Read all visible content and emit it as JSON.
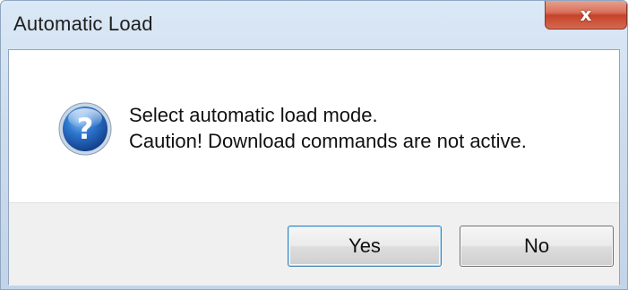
{
  "window": {
    "title": "Automatic Load",
    "close_symbol": "x",
    "close_icon": "close-icon"
  },
  "message": {
    "icon": "question-icon",
    "icon_glyph": "?",
    "line1": "Select automatic load mode.",
    "line2": "Caution! Download commands are not active."
  },
  "buttons": {
    "yes_label": "Yes",
    "no_label": "No"
  },
  "colors": {
    "title_bar": "#cddced",
    "close_button": "#c5432b",
    "question_icon": "#1f5fb3",
    "button_face": "#e6e6e6",
    "default_button_border": "#3c7fb1"
  }
}
